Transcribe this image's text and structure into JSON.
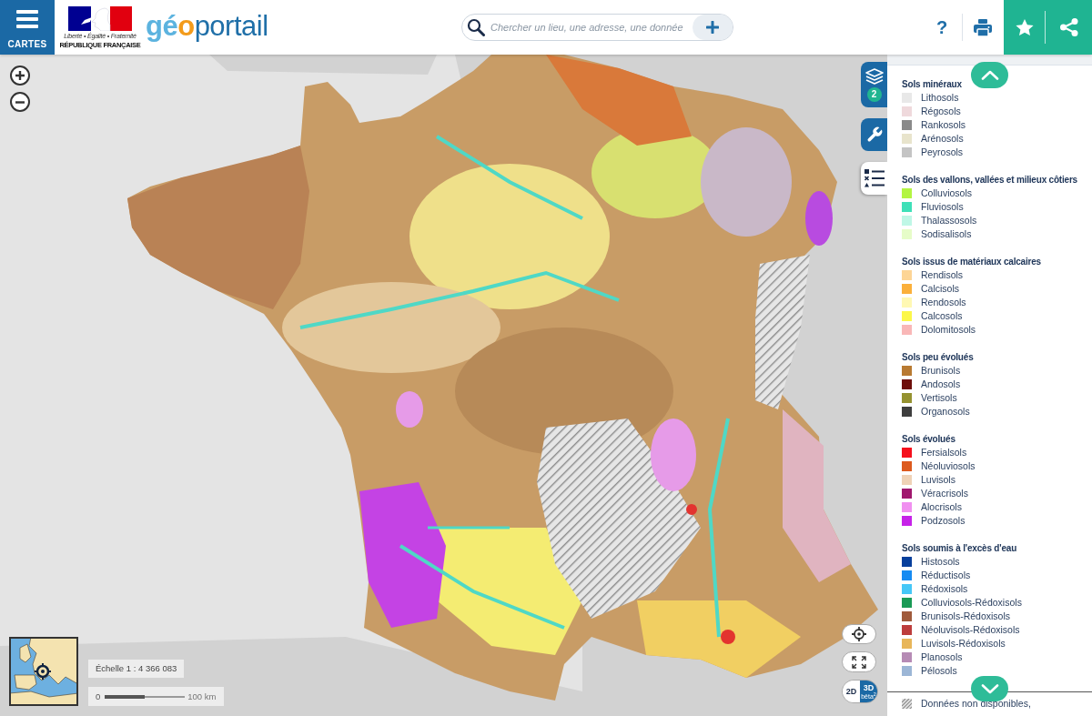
{
  "header": {
    "menu_button": {
      "label": "CARTES"
    },
    "emblem": {
      "motto": "Liberté • Égalité • Fraternité",
      "name": "RÉPUBLIQUE FRANÇAISE"
    },
    "site_logo": {
      "parts": [
        "gé",
        "o",
        "portail"
      ]
    },
    "search": {
      "placeholder": "Chercher un lieu, une adresse, une donnée"
    },
    "help_button": {
      "label": "?"
    }
  },
  "map": {
    "tools": [
      {
        "kind": "layers",
        "selected": false,
        "badge": "2"
      },
      {
        "kind": "tools",
        "selected": false
      },
      {
        "kind": "legend",
        "selected": true
      }
    ],
    "scale": {
      "label": "Échelle 1 : 4 366 083",
      "start": "0",
      "end": "100 km"
    },
    "view_modes": [
      {
        "label": "2D",
        "selected": false
      },
      {
        "label": "3D",
        "note": "bêta$^{2}$",
        "selected": true
      }
    ]
  },
  "legend": {
    "sections": [
      {
        "title": "Sols minéraux",
        "items": [
          {
            "label": "Lithosols",
            "color": "#e8e8e8"
          },
          {
            "label": "Régosols",
            "color": "#efd9dc"
          },
          {
            "label": "Rankosols",
            "color": "#8a8a8a"
          },
          {
            "label": "Arénosols",
            "color": "#e8e4cc"
          },
          {
            "label": "Peyrosols",
            "color": "#c4c4c4"
          }
        ]
      },
      {
        "title": "Sols des vallons, vallées et milieux côtiers",
        "items": [
          {
            "label": "Colluviosols",
            "color": "#b3f542"
          },
          {
            "label": "Fluviosols",
            "color": "#3fe0b8"
          },
          {
            "label": "Thalassosols",
            "color": "#bff7e6"
          },
          {
            "label": "Sodisalisols",
            "color": "#e6fcc8"
          }
        ]
      },
      {
        "title": "Sols issus de matériaux calcaires",
        "items": [
          {
            "label": "Rendisols",
            "color": "#fdd596"
          },
          {
            "label": "Calcisols",
            "color": "#fbb03b"
          },
          {
            "label": "Rendosols",
            "color": "#fff8b3"
          },
          {
            "label": "Calcosols",
            "color": "#fcf74a"
          },
          {
            "label": "Dolomitosols",
            "color": "#f9b7b7"
          }
        ]
      },
      {
        "title": "Sols peu évolués",
        "items": [
          {
            "label": "Brunisols",
            "color": "#b87a32"
          },
          {
            "label": "Andosols",
            "color": "#6e0e0a"
          },
          {
            "label": "Vertisols",
            "color": "#959230"
          },
          {
            "label": "Organosols",
            "color": "#3e3e3e"
          }
        ]
      },
      {
        "title": "Sols évolués",
        "items": [
          {
            "label": "Fersialsols",
            "color": "#f5101c"
          },
          {
            "label": "Néoluviosols",
            "color": "#dd5a1e"
          },
          {
            "label": "Luvisols",
            "color": "#efd2b6"
          },
          {
            "label": "Véracrisols",
            "color": "#a0176e"
          },
          {
            "label": "Alocrisols",
            "color": "#f090f0"
          },
          {
            "label": "Podzosols",
            "color": "#c622e8"
          }
        ]
      },
      {
        "title": "Sols soumis à l'excès d'eau",
        "items": [
          {
            "label": "Histosols",
            "color": "#073f9c"
          },
          {
            "label": "Réductisols",
            "color": "#168bf2"
          },
          {
            "label": "Rédoxisols",
            "color": "#45c7f7"
          },
          {
            "label": "Colluviosols-Rédoxisols",
            "color": "#1a9a55"
          },
          {
            "label": "Brunisols-Rédoxisols",
            "color": "#a05b3c"
          },
          {
            "label": "Néoluvisols-Rédoxisols",
            "color": "#bd3d3c"
          },
          {
            "label": "Luvisols-Rédoxisols",
            "color": "#e8b65a"
          },
          {
            "label": "Planosols",
            "color": "#b68bb5"
          },
          {
            "label": "Pélosols",
            "color": "#9cb6d6"
          }
        ]
      }
    ],
    "no_data": {
      "label": "Données non disponibles,"
    }
  }
}
